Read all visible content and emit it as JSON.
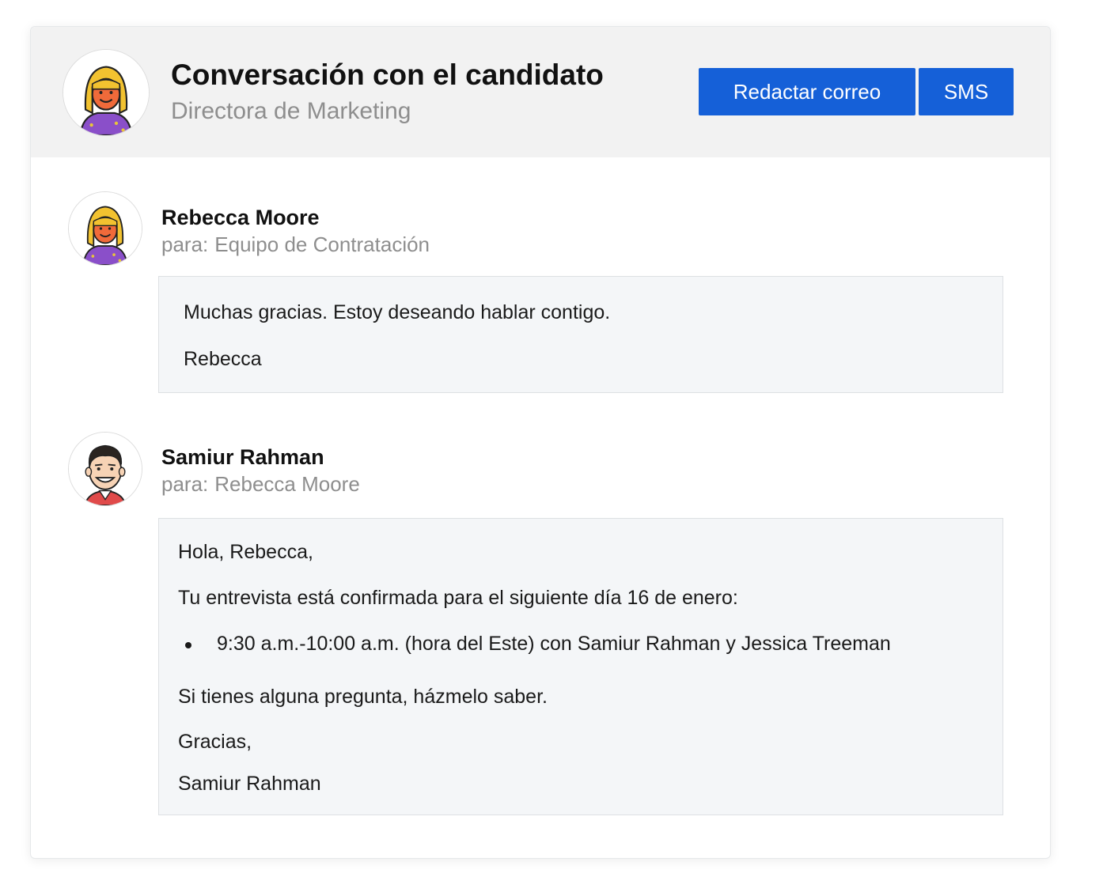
{
  "header": {
    "title": "Conversación con el candidato",
    "subtitle": "Directora de Marketing",
    "avatar_icon": "candidate-avatar-icon",
    "actions": {
      "email_label": "Redactar correo",
      "sms_label": "SMS"
    }
  },
  "colors": {
    "accent": "#1560d8",
    "header_bg": "#f2f2f2",
    "message_bg": "#f4f6f8"
  },
  "messages": [
    {
      "sender": "Rebecca Moore",
      "to_prefix": "para:",
      "to": "Equipo de Contratación",
      "avatar_icon": "rebecca-avatar-icon",
      "body": [
        "Muchas gracias. Estoy deseando hablar contigo.",
        "Rebecca"
      ]
    },
    {
      "sender": "Samiur Rahman",
      "to_prefix": "para:",
      "to": "Rebecca Moore",
      "avatar_icon": "samiur-avatar-icon",
      "greeting": "Hola, Rebecca,",
      "intro": "Tu entrevista está confirmada para el siguiente día 16 de enero:",
      "bullets": [
        "9:30 a.m.-10:00 a.m. (hora del Este) con Samiur Rahman y Jessica Treeman"
      ],
      "closing": "Si tienes alguna pregunta, házmelo saber.",
      "signoff": "Gracias,",
      "signature": "Samiur Rahman"
    }
  ]
}
